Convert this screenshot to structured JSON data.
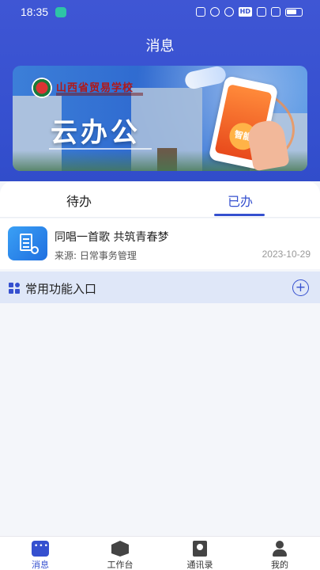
{
  "status_bar": {
    "time": "18:35",
    "hd_badge": "HD"
  },
  "header": {
    "title": "消息"
  },
  "banner": {
    "school_name": "山西省贸易学校",
    "headline": "云办公",
    "phone_badge": "智能"
  },
  "tabs": [
    {
      "label": "待办",
      "active": false
    },
    {
      "label": "已办",
      "active": true
    }
  ],
  "messages": [
    {
      "title": "同唱一首歌 共筑青春梦",
      "source_label": "来源:",
      "source": "日常事务管理",
      "date": "2023-10-29"
    }
  ],
  "functions": {
    "label": "常用功能入口",
    "add_symbol": "+"
  },
  "bottom_nav": [
    {
      "label": "消息",
      "icon": "message-icon",
      "active": true
    },
    {
      "label": "工作台",
      "icon": "workbench-icon",
      "active": false
    },
    {
      "label": "通讯录",
      "icon": "contacts-icon",
      "active": false
    },
    {
      "label": "我的",
      "icon": "profile-icon",
      "active": false
    }
  ],
  "colors": {
    "primary": "#3550cf",
    "function_bar": "#dfe7f8"
  }
}
